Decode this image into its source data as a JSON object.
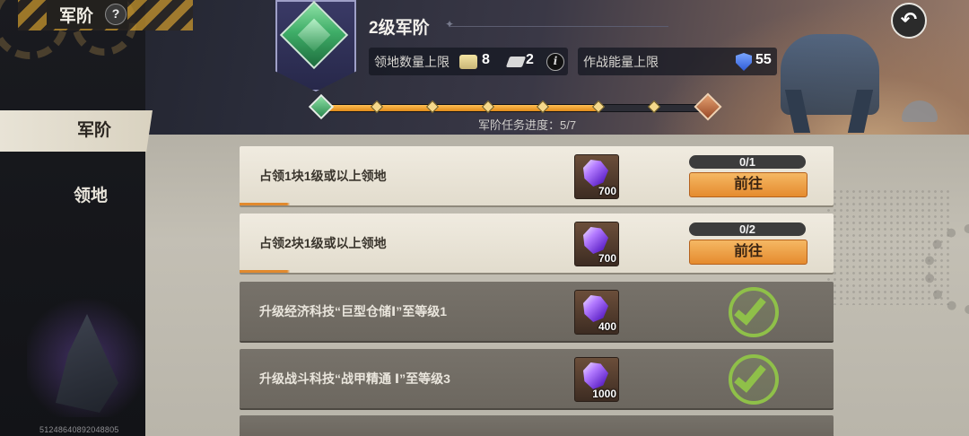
{
  "header": {
    "page_title": "军阶",
    "help_label": "?",
    "rank_title": "2级军阶",
    "back_icon": "back-arrow-icon"
  },
  "stats": {
    "territory_label": "领地数量上限",
    "builder_value": "8",
    "plot_value": "2",
    "info_label": "i",
    "power_label": "作战能量上限",
    "power_value": "55"
  },
  "progress": {
    "text": "军阶任务进度：5/7",
    "completed": 5,
    "total": 7
  },
  "sidebar": {
    "items": [
      {
        "label": "军阶",
        "active": true
      },
      {
        "label": "领地",
        "active": false
      }
    ],
    "uid": "51248640892048805"
  },
  "tasks": [
    {
      "text": "占领1块1级或以上领地",
      "reward": "700",
      "count": "0/1",
      "action": "前往",
      "done": false
    },
    {
      "text": "占领2块1级或以上领地",
      "reward": "700",
      "count": "0/2",
      "action": "前往",
      "done": false
    },
    {
      "text": "升级经济科技“巨型仓储Ⅰ”至等级1",
      "reward": "400",
      "done": true
    },
    {
      "text": "升级战斗科技“战甲精通 Ⅰ”至等级3",
      "reward": "1000",
      "done": true
    }
  ],
  "colors": {
    "accent_orange": "#e58b2e",
    "check_green": "#8fc049",
    "rank_green": "#3fae68"
  }
}
